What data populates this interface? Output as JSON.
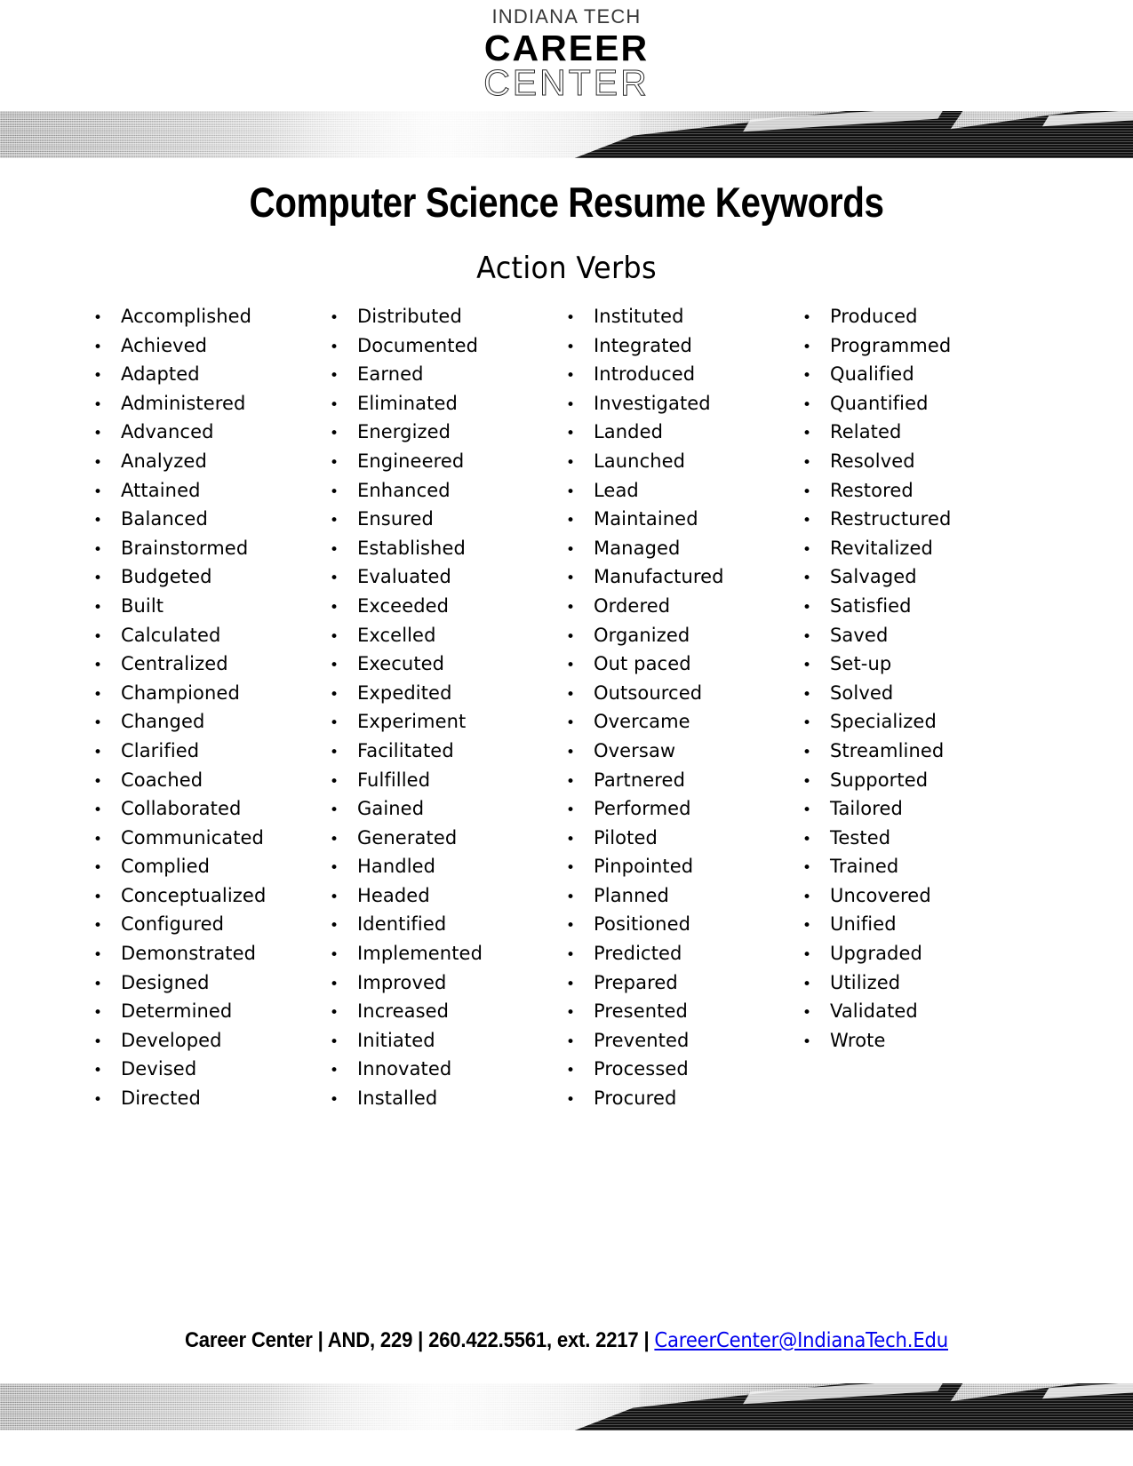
{
  "logo": {
    "line1": "INDIANA TECH",
    "line2": "CAREER",
    "line3": "CENTER"
  },
  "header": {
    "title": "Computer Science Resume Keywords",
    "subtitle": "Action Verbs"
  },
  "colors": {
    "text": "#000000",
    "band_gray": "#a8a8a8",
    "band_dark": "#111111",
    "page_background": "#ffffff"
  },
  "keywords": {
    "column1": [
      "Accomplished",
      "Achieved",
      "Adapted",
      "Administered",
      "Advanced",
      "Analyzed",
      "Attained",
      "Balanced",
      "Brainstormed",
      "Budgeted",
      "Built",
      "Calculated",
      "Centralized",
      "Championed",
      "Changed",
      "Clarified",
      "Coached",
      "Collaborated",
      "Communicated",
      "Complied",
      "Conceptualized",
      "Configured",
      "Demonstrated",
      "Designed",
      "Determined",
      "Developed",
      "Devised",
      "Directed"
    ],
    "column2": [
      "Distributed",
      "Documented",
      "Earned",
      "Eliminated",
      "Energized",
      "Engineered",
      "Enhanced",
      "Ensured",
      "Established",
      "Evaluated",
      "Exceeded",
      "Excelled",
      "Executed",
      "Expedited",
      "Experiment",
      "Facilitated",
      "Fulfilled",
      "Gained",
      "Generated",
      "Handled",
      "Headed",
      "Identified",
      "Implemented",
      "Improved",
      "Increased",
      "Initiated",
      "Innovated",
      "Installed"
    ],
    "column3": [
      "Instituted",
      "Integrated",
      "Introduced",
      "Investigated",
      "Landed",
      "Launched",
      "Lead",
      "Maintained",
      "Managed",
      "Manufactured",
      "Ordered",
      "Organized",
      "Out paced",
      "Outsourced",
      "Overcame",
      "Oversaw",
      "Partnered",
      "Performed",
      "Piloted",
      "Pinpointed",
      "Planned",
      "Positioned",
      "Predicted",
      "Prepared",
      "Presented",
      "Prevented",
      "Processed",
      "Procured"
    ],
    "column4": [
      "Produced",
      "Programmed",
      "Qualified",
      "Quantified",
      "Related",
      "Resolved",
      "Restored",
      "Restructured",
      "Revitalized",
      "Salvaged",
      "Satisfied",
      "Saved",
      "Set-up",
      "Solved",
      "Specialized",
      "Streamlined",
      "Supported",
      "Tailored",
      "Tested",
      "Trained",
      "Uncovered",
      "Unified",
      "Upgraded",
      "Utilized",
      "Validated",
      "Wrote"
    ]
  },
  "bullet_glyph": "•",
  "footer": {
    "office": "Career Center",
    "separator": " | ",
    "location": "AND, 229",
    "phone": "260.422.5561, ext. 2217",
    "email": "CareerCenter@IndianaTech.Edu",
    "full_text_prefix": "Career Center | AND, 229 | 260.422.5561, ext. 2217 | "
  }
}
